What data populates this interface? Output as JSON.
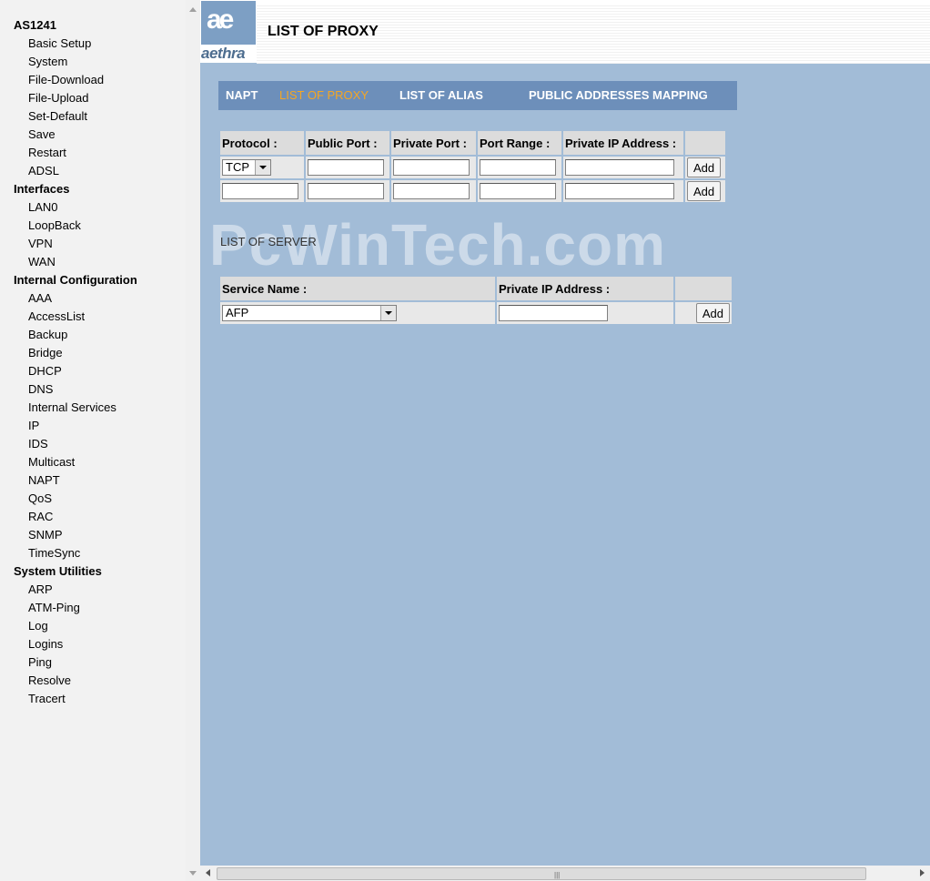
{
  "nav": {
    "groups": [
      {
        "title": "AS1241",
        "items": [
          "Basic Setup",
          "System",
          "File-Download",
          "File-Upload",
          "Set-Default",
          "Save",
          "Restart",
          "ADSL"
        ]
      },
      {
        "title": "Interfaces",
        "items": [
          "LAN0",
          "LoopBack",
          "VPN",
          "WAN"
        ]
      },
      {
        "title": "Internal Configuration",
        "items": [
          "AAA",
          "AccessList",
          "Backup",
          "Bridge",
          "DHCP",
          "DNS",
          "Internal Services",
          "IP",
          "IDS",
          "Multicast",
          "NAPT",
          "QoS",
          "RAC",
          "SNMP",
          "TimeSync"
        ]
      },
      {
        "title": "System Utilities",
        "items": [
          "ARP",
          "ATM-Ping",
          "Log",
          "Logins",
          "Ping",
          "Resolve",
          "Tracert"
        ]
      }
    ]
  },
  "header": {
    "logo_text": "aethra",
    "logo_mark": "ae",
    "title": "LIST OF PROXY"
  },
  "tabs": [
    {
      "label": "NAPT",
      "active": false
    },
    {
      "label": "LIST OF PROXY",
      "active": true
    },
    {
      "label": "LIST OF ALIAS",
      "active": false
    },
    {
      "label": "PUBLIC ADDRESSES MAPPING",
      "active": false
    }
  ],
  "proxy_table": {
    "headers": [
      "Protocol :",
      "Public Port :",
      "Private Port :",
      "Port Range :",
      "Private IP Address :"
    ],
    "row1": {
      "protocol": "TCP",
      "public_port": "",
      "private_port": "",
      "port_range": "",
      "private_ip": ""
    },
    "row2": {
      "protocol": "",
      "public_port": "",
      "private_port": "",
      "port_range": "",
      "private_ip": ""
    },
    "add_label": "Add"
  },
  "server_section": {
    "label": "LIST OF SERVER",
    "headers": [
      "Service Name :",
      "Private IP Address :"
    ],
    "service": "AFP",
    "private_ip": "",
    "add_label": "Add"
  },
  "watermark": "PcWinTech.com",
  "colors": {
    "content_bg": "#a2bcd7",
    "tab_bar": "#6d8fba",
    "tab_active": "#f5a623"
  }
}
